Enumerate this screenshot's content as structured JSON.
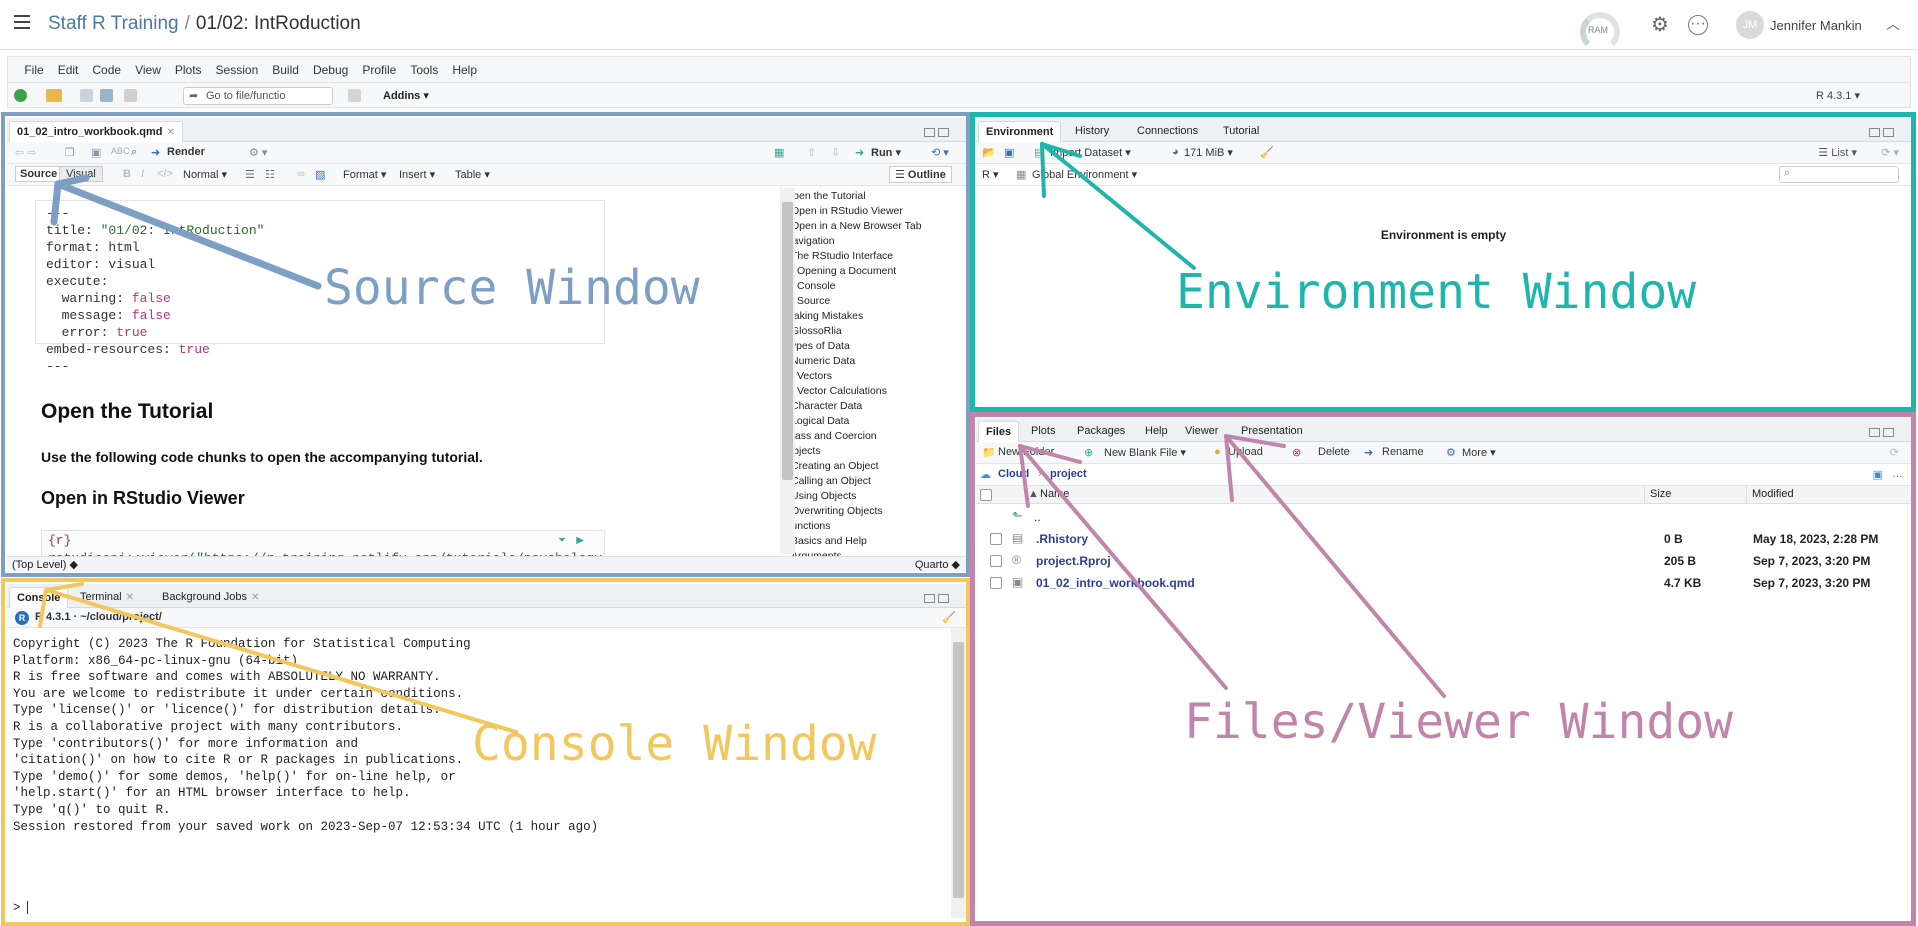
{
  "header": {
    "project": "Staff R Training",
    "separator": "/",
    "document": "01/02: IntRoduction",
    "ram_label": "RAM",
    "user_initials": "JM",
    "user_name": "Jennifer Mankin"
  },
  "menu": [
    "File",
    "Edit",
    "Code",
    "View",
    "Plots",
    "Session",
    "Build",
    "Debug",
    "Profile",
    "Tools",
    "Help"
  ],
  "main_toolbar": {
    "goto_placeholder": "Go to file/functio",
    "addins": "Addins",
    "r_version": "R 4.3.1"
  },
  "source": {
    "tab": "01_02_intro_workbook.qmd",
    "render": "Render",
    "run": "Run",
    "mode_source": "Source",
    "mode_visual": "Visual",
    "style": "Normal",
    "format": "Format",
    "insert": "Insert",
    "table": "Table",
    "outline": "Outline",
    "yaml": [
      {
        "k": "---",
        "v": ""
      },
      {
        "k": "title: ",
        "v": "\"01/02: IntRoduction\""
      },
      {
        "k": "format: ",
        "v": "html"
      },
      {
        "k": "editor: ",
        "v": "visual"
      },
      {
        "k": "execute:",
        "v": ""
      },
      {
        "k": "  warning: ",
        "v": "false"
      },
      {
        "k": "  message: ",
        "v": "false"
      },
      {
        "k": "  error: ",
        "v": "true"
      },
      {
        "k": "embed-resources: ",
        "v": "true"
      },
      {
        "k": "---",
        "v": ""
      }
    ],
    "h_open": "Open the Tutorial",
    "para": "Use the following code chunks to open the accompanying tutorial.",
    "h_viewer": "Open in RStudio Viewer",
    "chunk_label": "{r}",
    "chunk_code": "rstudioapi::viewer(\"https://r-training.netlify.app/tutorials/psychology",
    "status_left": "(Top Level)",
    "status_right": "Quarto",
    "outline_items": [
      {
        "t": "Open the Tutorial",
        "l": 0
      },
      {
        "t": "Open in RStudio Viewer",
        "l": 1
      },
      {
        "t": "Open in a New Browser Tab",
        "l": 1
      },
      {
        "t": "Navigation",
        "l": 0
      },
      {
        "t": "The RStudio Interface",
        "l": 1
      },
      {
        "t": "Opening a Document",
        "l": 2
      },
      {
        "t": "Console",
        "l": 2
      },
      {
        "t": "Source",
        "l": 2
      },
      {
        "t": "Making Mistakes",
        "l": 0
      },
      {
        "t": "GlossoRlia",
        "l": 1
      },
      {
        "t": "Types of Data",
        "l": 0
      },
      {
        "t": "Numeric Data",
        "l": 1
      },
      {
        "t": "Vectors",
        "l": 2
      },
      {
        "t": "Vector Calculations",
        "l": 2
      },
      {
        "t": "Character Data",
        "l": 1
      },
      {
        "t": "Logical Data",
        "l": 1
      },
      {
        "t": "Class and Coercion",
        "l": 0
      },
      {
        "t": "Objects",
        "l": 0
      },
      {
        "t": "Creating an Object",
        "l": 1
      },
      {
        "t": "Calling an Object",
        "l": 1
      },
      {
        "t": "Using Objects",
        "l": 1
      },
      {
        "t": "Overwriting Objects",
        "l": 1
      },
      {
        "t": "Functions",
        "l": 0
      },
      {
        "t": "Basics and Help",
        "l": 1
      },
      {
        "t": "Arguments",
        "l": 1
      }
    ]
  },
  "environment": {
    "tabs": [
      "Environment",
      "History",
      "Connections",
      "Tutorial"
    ],
    "import": "Import Dataset",
    "memory": "171 MiB",
    "list": "List",
    "lang": "R",
    "scope": "Global Environment",
    "empty": "Environment is empty"
  },
  "console": {
    "tabs": [
      "Console",
      "Terminal",
      "Background Jobs"
    ],
    "path": "R 4.3.1 · ~/cloud/project/",
    "lines": [
      "Copyright (C) 2023 The R Foundation for Statistical Computing",
      "Platform: x86_64-pc-linux-gnu (64-bit)",
      "",
      "R is free software and comes with ABSOLUTELY NO WARRANTY.",
      "You are welcome to redistribute it under certain conditions.",
      "Type 'license()' or 'licence()' for distribution details.",
      "",
      "R is a collaborative project with many contributors.",
      "Type 'contributors()' for more information and",
      "'citation()' on how to cite R or R packages in publications.",
      "",
      "Type 'demo()' for some demos, 'help()' for on-line help, or",
      "'help.start()' for an HTML browser interface to help.",
      "Type 'q()' to quit R.",
      "",
      "Session restored from your saved work on 2023-Sep-07 12:53:34 UTC (1 hour ago)"
    ],
    "prompt": ">"
  },
  "files": {
    "tabs": [
      "Files",
      "Plots",
      "Packages",
      "Help",
      "Viewer",
      "Presentation"
    ],
    "new_folder": "New Folder",
    "new_blank": "New Blank File",
    "upload": "Upload",
    "delete": "Delete",
    "rename": "Rename",
    "more": "More",
    "crumb_root": "Cloud",
    "crumb_child": "project",
    "col_name": "Name",
    "col_size": "Size",
    "col_modified": "Modified",
    "up": "..",
    "rows": [
      {
        "name": ".Rhistory",
        "size": "0 B",
        "modified": "May 18, 2023, 2:28 PM"
      },
      {
        "name": "project.Rproj",
        "size": "205 B",
        "modified": "Sep 7, 2023, 3:20 PM"
      },
      {
        "name": "01_02_intro_workbook.qmd",
        "size": "4.7 KB",
        "modified": "Sep 7, 2023, 3:20 PM"
      }
    ]
  },
  "annotations": {
    "source": "Source Window",
    "environment": "Environment Window",
    "console": "Console Window",
    "files": "Files/Viewer Window",
    "colors": {
      "source": "#7d9fc4",
      "environment": "#1fb5ad",
      "console": "#f1c75e",
      "files": "#c185ac"
    }
  }
}
